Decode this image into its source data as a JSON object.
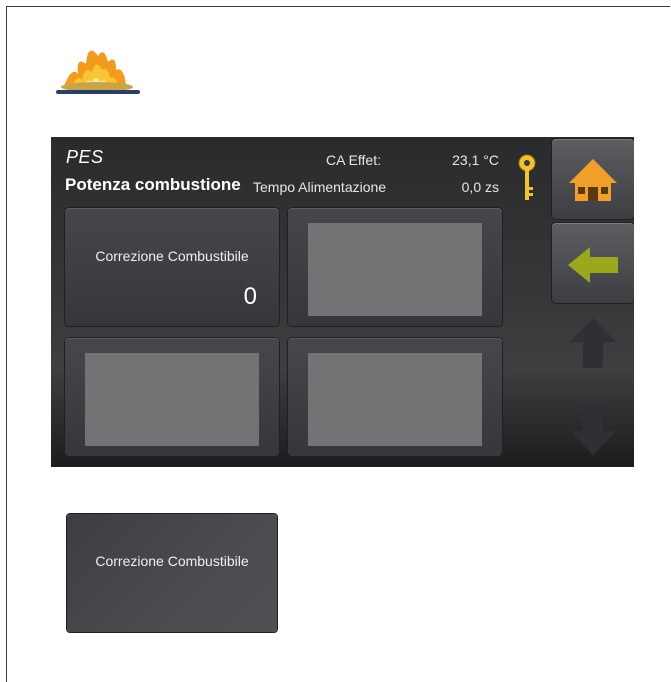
{
  "header": {
    "title": "PES",
    "subtitle": "Potenza combustione"
  },
  "status": {
    "ca_effet_label": "CA Effet:",
    "ca_effet_value": "23,1 °C",
    "tempo_label": "Tempo Alimentazione",
    "tempo_value": "0,0 zs"
  },
  "tiles": {
    "correzione_label": "Correzione Combustibile",
    "correzione_value": "0"
  },
  "sample_button": {
    "label": "Correzione Combustibile"
  },
  "icons": {
    "logo": "fire-icon",
    "lock": "key-icon",
    "home": "home-icon",
    "back": "back-arrow-icon",
    "up": "arrow-up-icon",
    "down": "arrow-down-icon"
  },
  "colors": {
    "accent_orange": "#f0a028",
    "accent_green": "#9aa81e",
    "key_yellow": "#f0c020",
    "screen_bg": "#353638"
  }
}
